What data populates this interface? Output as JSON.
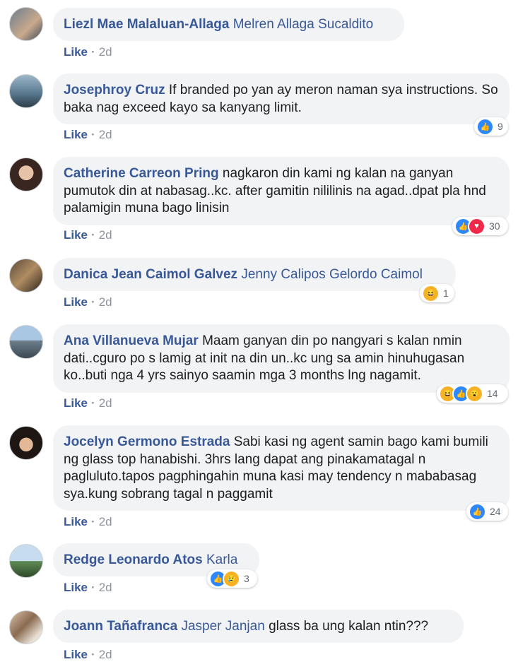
{
  "comments": [
    {
      "author": "Liezl Mae Malaluan-Allaga",
      "tags": "Melren Allaga Sucaldito",
      "text": "",
      "like": "Like",
      "time": "2d",
      "reactions": [],
      "count": ""
    },
    {
      "author": "Josephroy Cruz",
      "tags": "",
      "text": "If branded po yan ay meron naman sya instructions. So baka nag exceed kayo sa kanyang limit.",
      "like": "Like",
      "time": "2d",
      "reactions": [
        "like"
      ],
      "count": "9"
    },
    {
      "author": "Catherine Carreon Pring",
      "tags": "",
      "text": "nagkaron din kami ng kalan na ganyan pumutok din at nabasag..kc. after gamitin nililinis na agad..dpat pla hnd palamigin muna bago linisin",
      "like": "Like",
      "time": "2d",
      "reactions": [
        "like",
        "love"
      ],
      "count": "30"
    },
    {
      "author": "Danica Jean Caimol Galvez",
      "tags": "Jenny Calipos Gelordo Caimol",
      "text": "",
      "like": "Like",
      "time": "2d",
      "reactions": [
        "haha"
      ],
      "count": "1"
    },
    {
      "author": "Ana Villanueva Mujar",
      "tags": "",
      "text": "Maam ganyan din po nangyari s kalan nmin dati..cguro po s lamig at init na din un..kc ung sa amin hinuhugasan ko..buti nga 4 yrs sainyo saamin mga 3 months lng nagamit.",
      "like": "Like",
      "time": "2d",
      "reactions": [
        "haha",
        "like",
        "wow"
      ],
      "count": "14"
    },
    {
      "author": "Jocelyn Germono Estrada",
      "tags": "",
      "text": "Sabi kasi ng agent samin bago kami bumili ng glass top hanabishi. 3hrs lang dapat ang pinakamatagal n pagluluto.tapos pagphingahin muna kasi may tendency n mababasag sya.kung sobrang tagal n paggamit",
      "like": "Like",
      "time": "2d",
      "reactions": [
        "like"
      ],
      "count": "24"
    },
    {
      "author": "Redge Leonardo Atos",
      "tags": "Karla",
      "text": "",
      "like": "Like",
      "time": "2d",
      "reactions": [
        "like",
        "sad"
      ],
      "count": "3"
    },
    {
      "author": "Joann Tañafranca",
      "tags": "Jasper Janjan",
      "text": "glass ba ung kalan ntin???",
      "like": "Like",
      "time": "2d",
      "reactions": [],
      "count": ""
    }
  ],
  "icons": {
    "like": "thumbs-up",
    "love": "heart",
    "haha": "laughing-face",
    "wow": "surprised-face",
    "sad": "sad-face"
  },
  "colors": {
    "link": "#385898",
    "bubble": "#f2f3f5",
    "meta": "#90949c",
    "like_blue": "#2d88ff",
    "love_red": "#f0284a",
    "emoji_yellow": "#f7b125"
  }
}
